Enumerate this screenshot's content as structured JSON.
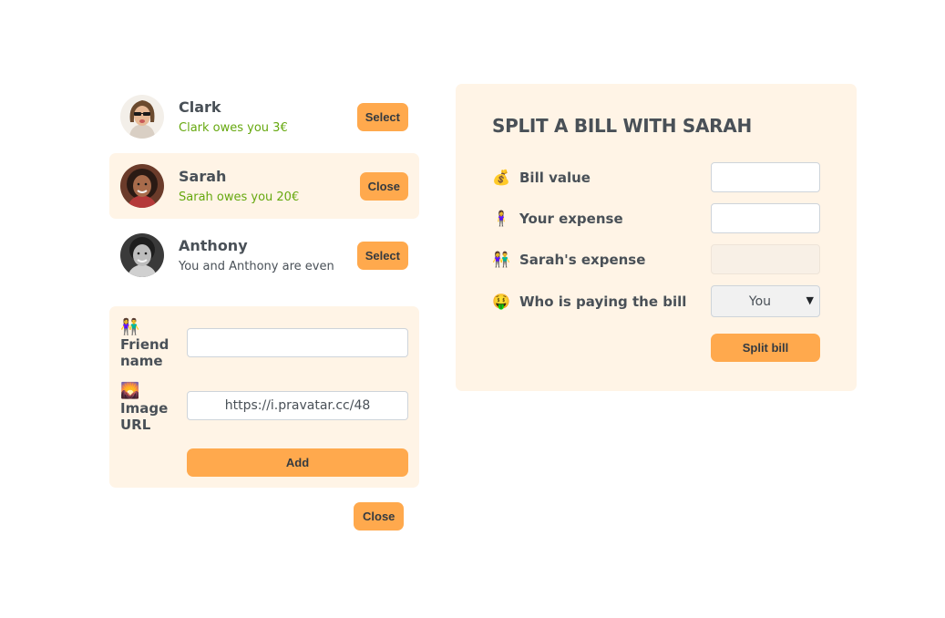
{
  "friends": [
    {
      "name": "Clark",
      "balance_text": "Clark owes you 3€",
      "button_label": "Select",
      "selected": false
    },
    {
      "name": "Sarah",
      "balance_text": "Sarah owes you 20€",
      "button_label": "Close",
      "selected": true
    },
    {
      "name": "Anthony",
      "balance_text": "You and Anthony are even",
      "button_label": "Select",
      "selected": false
    }
  ],
  "add_friend_form": {
    "name_label": "Friend name",
    "name_icon": "👫",
    "name_value": "",
    "image_label": "Image URL",
    "image_icon": "🌄",
    "image_value": "https://i.pravatar.cc/48",
    "add_button": "Add"
  },
  "close_form_button": "Close",
  "split_form": {
    "title": "SPLIT A BILL WITH SARAH",
    "bill_icon": "💰",
    "bill_label": "Bill value",
    "bill_value": "",
    "your_icon": "🧍‍♀️",
    "your_label": "Your expense",
    "your_value": "",
    "friend_icon": "👫",
    "friend_label": "Sarah's expense",
    "friend_value": "",
    "payer_icon": "🤑",
    "payer_label": "Who is paying the bill",
    "payer_selected": "You",
    "split_button": "Split bill"
  },
  "colors": {
    "accent": "#ffa94d",
    "panel_bg": "#fff4e6",
    "positive": "#66a80f",
    "text": "#495057"
  }
}
